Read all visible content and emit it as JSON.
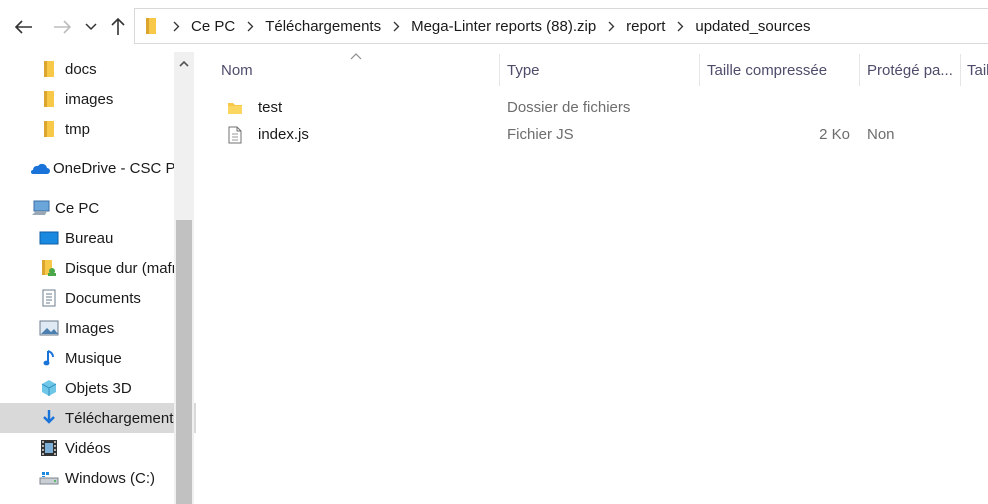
{
  "breadcrumb": {
    "items": [
      "Ce PC",
      "Téléchargements",
      "Mega-Linter reports (88).zip",
      "report",
      "updated_sources"
    ]
  },
  "sidebar": {
    "items": [
      {
        "label": "docs",
        "icon": "folder-icon"
      },
      {
        "label": "images",
        "icon": "folder-icon"
      },
      {
        "label": "tmp",
        "icon": "folder-icon"
      },
      {
        "label": "OneDrive - CSC Pr",
        "icon": "onedrive-icon"
      },
      {
        "label": "Ce PC",
        "icon": "computer-icon"
      },
      {
        "label": "Bureau",
        "icon": "desktop-icon"
      },
      {
        "label": "Disque dur (mafr",
        "icon": "user-folder-icon"
      },
      {
        "label": "Documents",
        "icon": "documents-icon"
      },
      {
        "label": "Images",
        "icon": "pictures-icon"
      },
      {
        "label": "Musique",
        "icon": "music-icon"
      },
      {
        "label": "Objets 3D",
        "icon": "objects-3d-icon"
      },
      {
        "label": "Téléchargements",
        "icon": "downloads-icon",
        "selected": true
      },
      {
        "label": "Vidéos",
        "icon": "videos-icon"
      },
      {
        "label": "Windows (C:)",
        "icon": "drive-icon"
      }
    ]
  },
  "columns": {
    "name": "Nom",
    "type": "Type",
    "compressed_size": "Taille compressée",
    "protected": "Protégé pa...",
    "size": "Tail"
  },
  "files": [
    {
      "name": "test",
      "type": "Dossier de fichiers",
      "compressed_size": "",
      "protected": "",
      "icon": "folder-icon"
    },
    {
      "name": "index.js",
      "type": "Fichier JS",
      "compressed_size": "2 Ko",
      "protected": "Non",
      "icon": "file-icon"
    }
  ],
  "colors": {
    "folder": "#f8c948",
    "folder_dark": "#dca530",
    "selection": "#d9d9d9",
    "header_text": "#4d4d6b"
  }
}
